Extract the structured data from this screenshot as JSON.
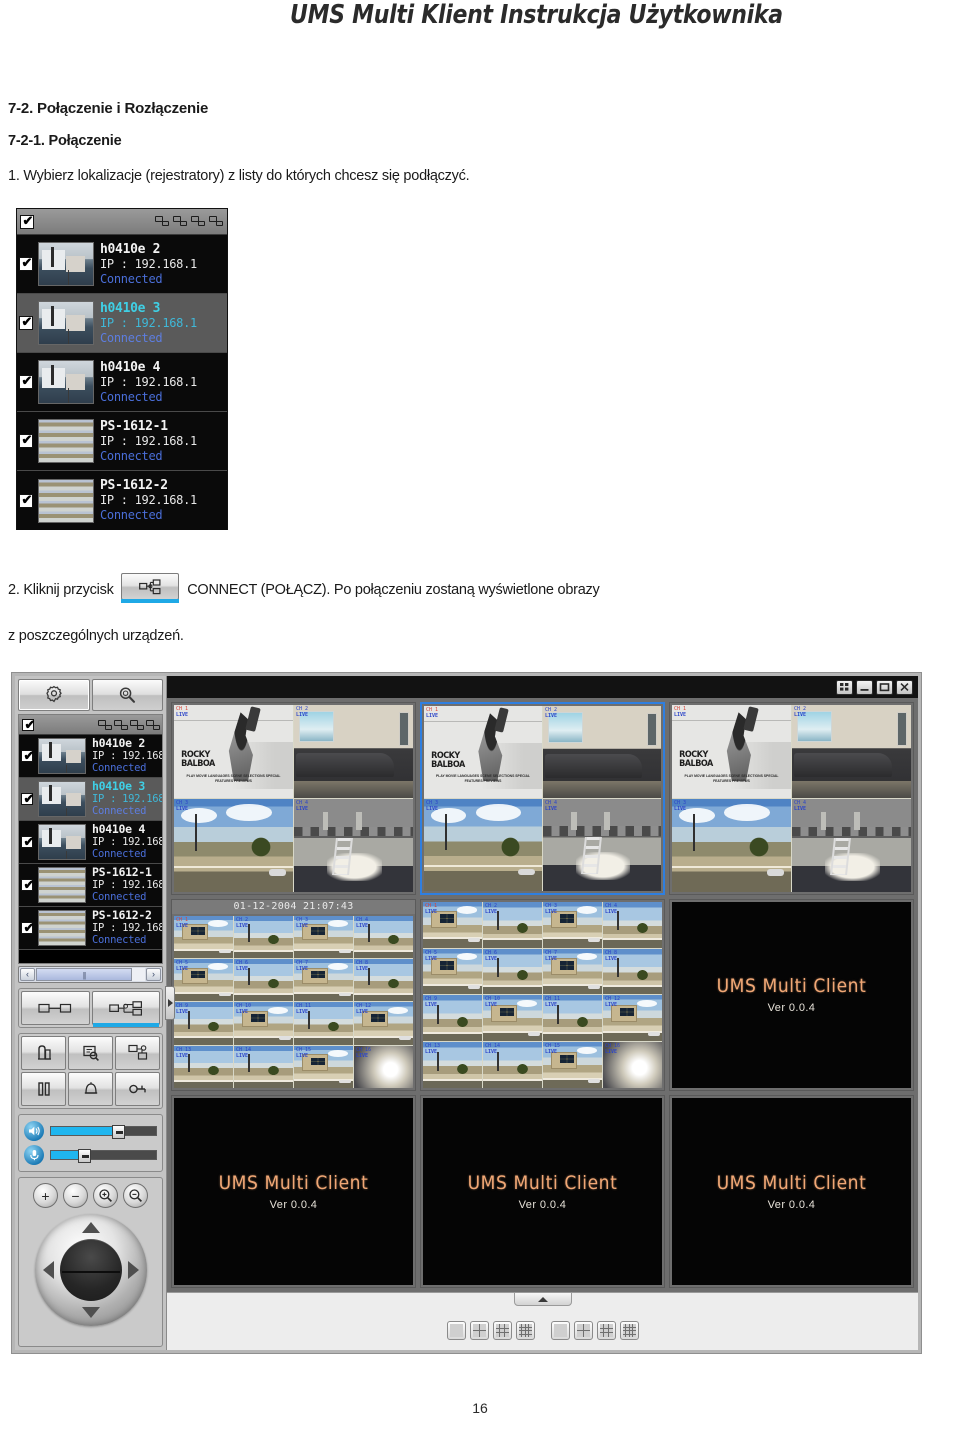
{
  "document": {
    "header_title": "UMS Multi Klient Instrukcja Użytkownika",
    "page_number": "16"
  },
  "section": {
    "heading": "7-2. Połączenie i Rozłączenie",
    "subheading": "7-2-1. Połączenie",
    "step1": "1. Wybierz lokalizacje (rejestratory) z listy do których chcesz się podłączyć.",
    "step2_before": "2. Kliknij przycisk",
    "step2_after": "CONNECT (POŁĄCZ). Po połączeniu zostaną wyświetlone obrazy",
    "step2_tail": "z poszczególnych urządzeń.",
    "connect_button_icon": "connect-network-icon"
  },
  "device_list": {
    "header": {
      "select_all_checkbox": "checked",
      "icons": [
        "site-list-icon",
        "site-add-icon",
        "site-delete-icon",
        "site-edit-icon"
      ]
    },
    "items": [
      {
        "name": "h0410e 2",
        "ip": "IP : 192.168.1",
        "status": "Connected",
        "checked": true,
        "selected": false,
        "thumb": "single-camera-boat"
      },
      {
        "name": "h0410e 3",
        "ip": "IP : 192.168.1",
        "status": "Connected",
        "checked": true,
        "selected": true,
        "thumb": "single-camera-boat"
      },
      {
        "name": "h0410e 4",
        "ip": "IP : 192.168.1",
        "status": "Connected",
        "checked": true,
        "selected": false,
        "thumb": "single-camera-boat"
      },
      {
        "name": "PS-1612-1",
        "ip": "IP : 192.168.1",
        "status": "Connected",
        "checked": true,
        "selected": false,
        "thumb": "multi-camera-mosaic"
      },
      {
        "name": "PS-1612-2",
        "ip": "IP : 192.168.1",
        "status": "Connected",
        "checked": true,
        "selected": false,
        "thumb": "multi-camera-mosaic"
      }
    ]
  },
  "app": {
    "splash_name": "UMS Multi Client",
    "splash_version": "Ver 0.0.4",
    "timestamp": "01-12-2004 21:07:43",
    "tabs": [
      {
        "name": "setup-tab",
        "icon": "gear-icon"
      },
      {
        "name": "search-tab",
        "icon": "magnifier-icon"
      }
    ],
    "window_buttons": [
      {
        "name": "expand-button",
        "icon": "expand-icon"
      },
      {
        "name": "minimize-button",
        "icon": "minimize-icon"
      },
      {
        "name": "maximize-button",
        "icon": "maximize-icon"
      },
      {
        "name": "close-button",
        "icon": "close-icon"
      }
    ],
    "scrollbar": {
      "left_arrow": "‹",
      "right_arrow": "›"
    },
    "tool_buttons": [
      {
        "name": "disconnect-button",
        "icon": "disconnect-icon",
        "highlighted": false
      },
      {
        "name": "connect-button",
        "icon": "connect-network-icon",
        "highlighted": true
      },
      {
        "name": "playback-button",
        "icon": "playback-icon",
        "highlighted": false
      },
      {
        "name": "search-log-button",
        "icon": "log-search-icon",
        "highlighted": false
      },
      {
        "name": "remote-setup-button",
        "icon": "remote-setup-icon",
        "highlighted": false
      },
      {
        "name": "pause-button",
        "icon": "pause-icon",
        "highlighted": false
      },
      {
        "name": "alarm-button",
        "icon": "alarm-bell-icon",
        "highlighted": false
      },
      {
        "name": "ptz-key-button",
        "icon": "ptz-key-icon",
        "highlighted": false
      }
    ],
    "sliders": [
      {
        "name": "volume-slider",
        "icon": "speaker-icon",
        "value": 62
      },
      {
        "name": "mic-slider",
        "icon": "microphone-icon",
        "value": 30
      }
    ],
    "ptz": {
      "focus_in": "+",
      "focus_out": "−",
      "zoom_in": "zoom-in-icon",
      "zoom_out": "zoom-out-icon",
      "joystick": "ptz-joystick"
    },
    "layout_buttons": [
      {
        "name": "layout-1x1-button",
        "cells": 1
      },
      {
        "name": "layout-2x2-button",
        "cells": 4
      },
      {
        "name": "layout-3x3-button",
        "cells": 9
      },
      {
        "name": "layout-4x4-button",
        "cells": 16
      },
      {
        "name": "layout-1x1-alt-button",
        "cells": 1
      },
      {
        "name": "layout-2x2-alt-button",
        "cells": 4
      },
      {
        "name": "layout-3x3-alt-button",
        "cells": 9
      },
      {
        "name": "layout-4x4-alt-button",
        "cells": 16
      }
    ],
    "panels": [
      {
        "name": "video-panel-1",
        "mode": "quad",
        "selected": false,
        "timestamp": ""
      },
      {
        "name": "video-panel-2",
        "mode": "quad",
        "selected": true,
        "timestamp": ""
      },
      {
        "name": "video-panel-3",
        "mode": "quad",
        "selected": false,
        "timestamp": ""
      },
      {
        "name": "video-panel-4",
        "mode": "sixteen",
        "selected": false,
        "timestamp": "01-12-2004 21:07:43"
      },
      {
        "name": "video-panel-5",
        "mode": "sixteen",
        "selected": false,
        "timestamp": ""
      },
      {
        "name": "video-panel-6",
        "mode": "splash",
        "selected": false,
        "timestamp": ""
      },
      {
        "name": "video-panel-7",
        "mode": "splash",
        "selected": false,
        "timestamp": ""
      },
      {
        "name": "video-panel-8",
        "mode": "splash",
        "selected": false,
        "timestamp": ""
      },
      {
        "name": "video-panel-9",
        "mode": "splash",
        "selected": false,
        "timestamp": ""
      }
    ],
    "quad_channels": [
      {
        "label_top": "CH 1",
        "label_bot": "LIVE",
        "scene": "rocky-balboa-dvd-menu"
      },
      {
        "label_top": "CH 2",
        "label_bot": "LIVE",
        "scene": "indoor-room"
      },
      {
        "label_top": "CH 3",
        "label_bot": "LIVE",
        "scene": "road-sky"
      },
      {
        "label_top": "CH 4",
        "label_bot": "LIVE",
        "scene": "parking-garage-ladder"
      }
    ],
    "splash_colors": {
      "name": "#f0a775",
      "version": "#e8e3da"
    },
    "accent_color": "#1fa9e6",
    "selected_border_color": "#2f7fe0",
    "status_color": "#4a6ed8",
    "selected_row_color": "#3fd0e6"
  },
  "rocky": {
    "title_l1": "ROCKY",
    "title_l2": "BALBOA",
    "menu": "PLAY MOVIE   LANGUAGES   SCENE SELECTIONS  SPECIAL FEATURES   PREVIEWS"
  }
}
